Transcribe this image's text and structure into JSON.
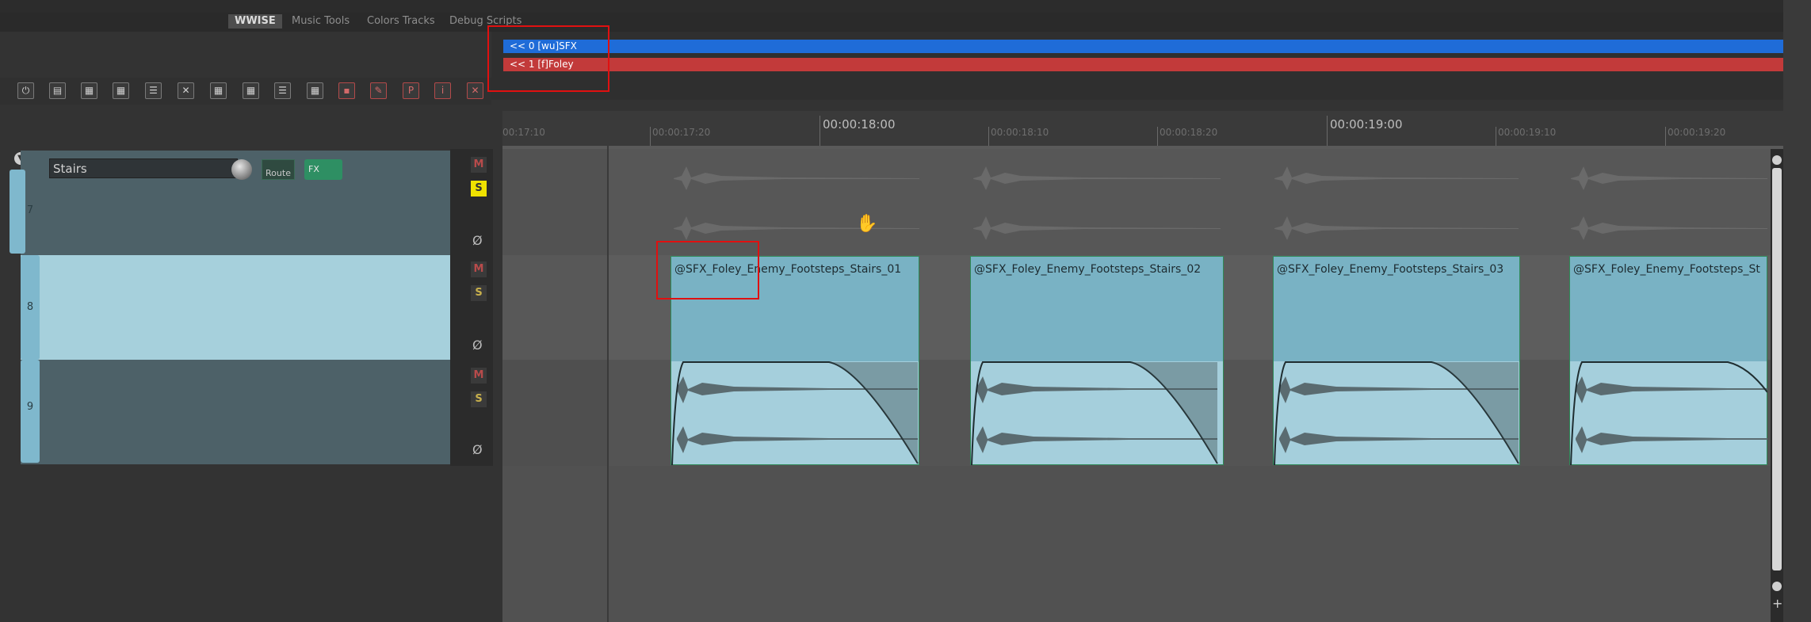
{
  "tabs": [
    {
      "label": "WWISE",
      "active": true
    },
    {
      "label": "Music Tools",
      "active": false
    },
    {
      "label": "Colors Tracks",
      "active": false
    },
    {
      "label": "Debug Scripts",
      "active": false
    }
  ],
  "regions": [
    {
      "label": "<< 0 [wu]SFX",
      "color": "#1f6cd8"
    },
    {
      "label": "<< 1 [f]Foley",
      "color": "#c23a3a"
    }
  ],
  "ruler": {
    "major": [
      "00:00:18:00",
      "00:00:19:00"
    ],
    "minor": [
      "00:17:10",
      "00:00:17:20",
      "00:00:18:10",
      "00:00:18:20",
      "00:00:19:10",
      "00:00:19:20"
    ]
  },
  "track_name": "Stairs",
  "route_label": "Route",
  "fx_label": "FX",
  "tracks": [
    {
      "number": "7",
      "mute": "M",
      "solo": "S",
      "phase": "Ø",
      "solo_active": true
    },
    {
      "number": "8",
      "mute": "M",
      "solo": "S",
      "phase": "Ø",
      "solo_active": false
    },
    {
      "number": "9",
      "mute": "M",
      "solo": "S",
      "phase": "Ø",
      "solo_active": false
    }
  ],
  "items": [
    {
      "name": "@SFX_Foley_Enemy_Footsteps_Stairs_01"
    },
    {
      "name": "@SFX_Foley_Enemy_Footsteps_Stairs_02"
    },
    {
      "name": "@SFX_Foley_Enemy_Footsteps_Stairs_03"
    },
    {
      "name": "@SFX_Foley_Enemy_Footsteps_St"
    }
  ],
  "colors": {
    "region_sfx": "#1f6cd8",
    "region_foley": "#c23a3a",
    "item_fill": "#79b2c4",
    "annotation": "#e01010"
  },
  "icons": [
    "routing-icon",
    "folder-icon",
    "grid-icon",
    "grid-icon",
    "list-icon",
    "close-x-icon",
    "grid-icon",
    "grid-icon",
    "list-icon",
    "grid-icon",
    "box-icon",
    "edit-icon",
    "p-icon",
    "i-icon",
    "x-icon"
  ]
}
